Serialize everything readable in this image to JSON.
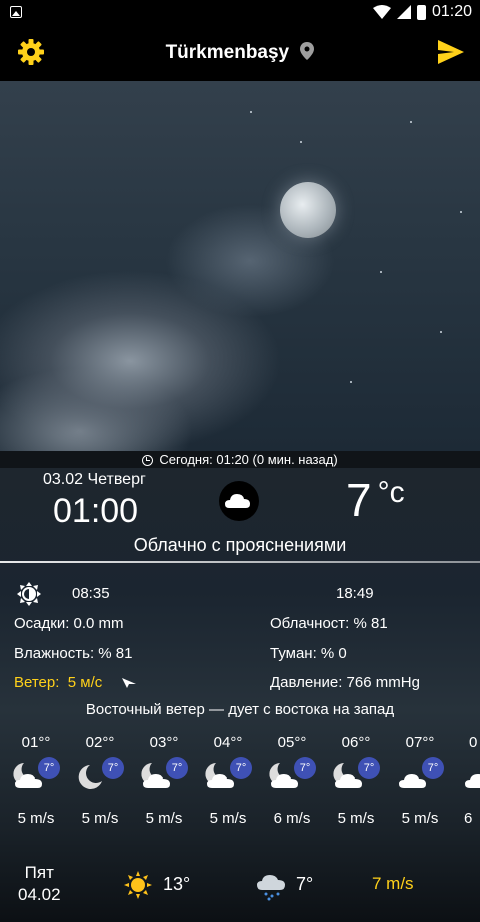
{
  "status": {
    "time": "01:20"
  },
  "header": {
    "city": "Türkmenbaşy"
  },
  "updated": "Сегодня: 01:20 (0 мин. назад)",
  "current": {
    "date": "03.02 Четверг",
    "time": "01:00",
    "temp": "7",
    "unit": "°c",
    "condition": "Облачно с прояснениями"
  },
  "details": {
    "sunrise": "08:35",
    "sunset": "18:49",
    "precip": "Осадки:  0.0 mm",
    "cloudiness": "Облачност:  % 81",
    "humidity": "Влажность:  % 81",
    "fog": "Туман:  % 0",
    "wind_label": "Ветер:",
    "wind_value": "5 м/с",
    "pressure": "Давление: 766 mmHg",
    "wind_desc": "Восточный ветер — дует с востока на запад"
  },
  "hourly": [
    {
      "hour": "01°°",
      "temp": "7°",
      "wind": "5 m/s"
    },
    {
      "hour": "02°°",
      "temp": "7°",
      "wind": "5 m/s"
    },
    {
      "hour": "03°°",
      "temp": "7°",
      "wind": "5 m/s"
    },
    {
      "hour": "04°°",
      "temp": "7°",
      "wind": "5 m/s"
    },
    {
      "hour": "05°°",
      "temp": "7°",
      "wind": "6 m/s"
    },
    {
      "hour": "06°°",
      "temp": "7°",
      "wind": "5 m/s"
    },
    {
      "hour": "07°°",
      "temp": "7°",
      "wind": "5 m/s"
    },
    {
      "hour": "0",
      "temp": "",
      "wind": "6"
    }
  ],
  "daily": {
    "day": "Пят",
    "date": "04.02",
    "high": "13°",
    "low": "7°",
    "wind": "7 m/s"
  },
  "colors": {
    "accent": "#ffd11a",
    "badge": "#3f51b5"
  }
}
